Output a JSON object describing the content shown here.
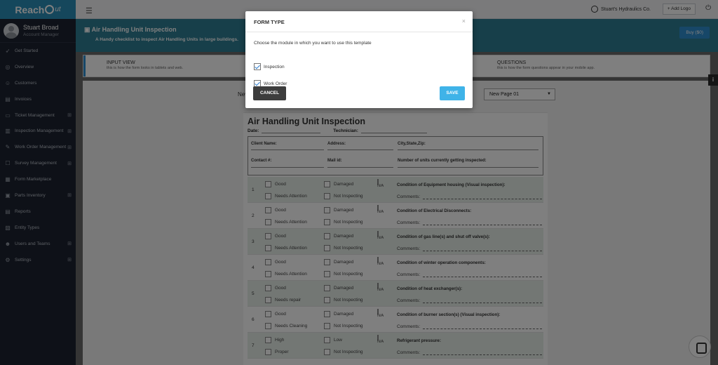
{
  "app": {
    "logo_main": "Reach",
    "logo_tail": "ut"
  },
  "user": {
    "name": "Stuart Broad",
    "role": "Account Manager"
  },
  "sidebar": {
    "items": [
      {
        "label": "Get Started",
        "icon": "rocket-icon",
        "expandable": false
      },
      {
        "label": "Overview",
        "icon": "globe-icon",
        "expandable": false
      },
      {
        "label": "Customers",
        "icon": "users-icon",
        "expandable": false
      },
      {
        "label": "Invoices",
        "icon": "invoice-icon",
        "expandable": false
      },
      {
        "label": "Ticket Management",
        "icon": "ticket-icon",
        "expandable": true
      },
      {
        "label": "Inspection Management",
        "icon": "clipboard-icon",
        "expandable": true
      },
      {
        "label": "Work Order Management",
        "icon": "wrench-icon",
        "expandable": true
      },
      {
        "label": "Survey Management",
        "icon": "survey-icon",
        "expandable": true
      },
      {
        "label": "Form Marketplace",
        "icon": "form-icon",
        "expandable": false
      },
      {
        "label": "Parts Inventory",
        "icon": "box-icon",
        "expandable": true
      },
      {
        "label": "Reports",
        "icon": "report-icon",
        "expandable": false
      },
      {
        "label": "Entity Types",
        "icon": "entity-icon",
        "expandable": false
      },
      {
        "label": "Users and Teams",
        "icon": "team-icon",
        "expandable": true
      },
      {
        "label": "Settings",
        "icon": "gear-icon",
        "expandable": true
      }
    ]
  },
  "topbar": {
    "company": "Stuart's Hydraulics Co.",
    "add_logo": "+ Add Logo"
  },
  "header": {
    "title": "Air Handling Unit Inspection",
    "subtitle": "A Handy checklist to inspect Air Handling Units in large buildings.",
    "buy_label": "Buy ($0)"
  },
  "view_tabs": {
    "input": {
      "title": "INPUT VIEW",
      "desc": "this is how the form looks in tablets and web."
    },
    "questions": {
      "title": "QUESTIONS",
      "desc": "this is how the form questions appear in your mobile app."
    }
  },
  "page": {
    "new_label": "Nev",
    "selected_page": "New Page 01"
  },
  "form": {
    "title": "Air Handling Unit Inspection",
    "date_label": "Date:",
    "tech_label": "Technician:",
    "client": {
      "name": "Client Name:",
      "address": "Address:",
      "city": "City,State,Zip:",
      "contact": "Contact #:",
      "mail": "Mail id:",
      "units": "Number of units currently getting inspected:"
    },
    "na_label": "N/A",
    "comments_label": "Comments:",
    "rows": [
      {
        "num": "1",
        "a": "Good",
        "b": "Damaged",
        "c": "Needs Attention",
        "d": "Not Inspecting",
        "cond": "Condition of Equipment housing (Visual inspection):"
      },
      {
        "num": "2",
        "a": "Good",
        "b": "Damaged",
        "c": "Needs Attention",
        "d": "Not Inspecting",
        "cond": "Condition of Electrical Disconnects:"
      },
      {
        "num": "3",
        "a": "Good",
        "b": "Damaged",
        "c": "Needs Attention",
        "d": "Not Inspecting",
        "cond": "Condition of gas line(s) and shut off valve(s):"
      },
      {
        "num": "4",
        "a": "Good",
        "b": "Damaged",
        "c": "Needs Attention",
        "d": "Not Inspecting",
        "cond": "Condition of winter operation components:"
      },
      {
        "num": "5",
        "a": "Good",
        "b": "Damaged",
        "c": "Needs repair",
        "d": "Not Inspecting",
        "cond": "Condition of heat exchanger(s):"
      },
      {
        "num": "6",
        "a": "Good",
        "b": "Damaged",
        "c": "Needs Cleaning",
        "d": "Not Inspecting",
        "cond": "Condition of burner section(s) (Visual inspection):"
      },
      {
        "num": "7",
        "a": "High",
        "b": "Low",
        "c": "Proper",
        "d": "Not Inspecting",
        "cond": "Refrigerant pressure:"
      }
    ]
  },
  "modal": {
    "title": "FORM TYPE",
    "close": "×",
    "prompt": "Choose the module in which you want to use this template",
    "options": [
      {
        "label": "Inspection",
        "checked": true
      },
      {
        "label": "Work Order",
        "checked": true
      }
    ],
    "cancel_label": "CANCEL",
    "save_label": "SAVE"
  },
  "colors": {
    "sidebar": "#1d2330",
    "header": "#2f7f95",
    "save": "#3fb3e8",
    "cancel": "#3d3d3d"
  }
}
